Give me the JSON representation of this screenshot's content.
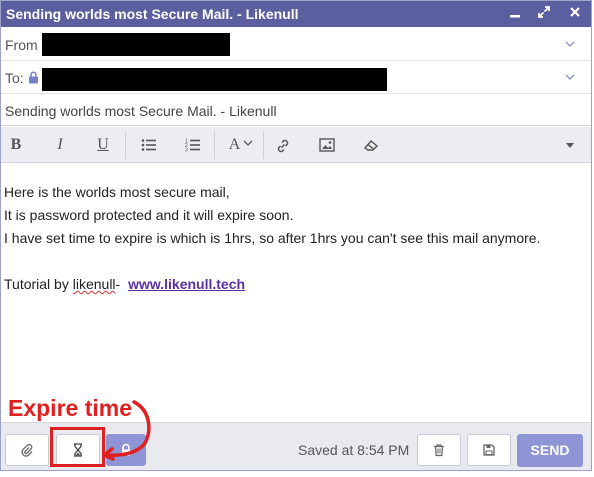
{
  "window": {
    "title": "Sending worlds most Secure Mail. - Likenull",
    "controls": [
      "minimize-icon",
      "maximize-icon",
      "close-icon"
    ]
  },
  "compose": {
    "from_label": "From",
    "to_label": "To:",
    "subject": "Sending worlds most Secure Mail. - Likenull"
  },
  "toolbar": {
    "bold": "B",
    "italic": "I",
    "underline": "U",
    "font_size": "A",
    "icons": [
      "bullet-list-icon",
      "numbered-list-icon",
      "font-size-icon",
      "link-icon",
      "image-icon",
      "eraser-icon",
      "more-dropdown-icon"
    ]
  },
  "body": {
    "line1": "Here is the worlds most secure mail,",
    "line2": "It is password protected and it will expire soon.",
    "line3": "I have set time to expire is which is 1hrs, so after 1hrs you can't see this mail anymore.",
    "line4_prefix": "Tutorial by ",
    "line4_name": "likenull",
    "line4_dash": "- ",
    "link": "www.likenull.tech"
  },
  "footer": {
    "saved_text": "Saved at 8:54 PM",
    "send_label": "SEND"
  },
  "annotation": {
    "label": "Expire time",
    "color": "#e02020"
  },
  "colors": {
    "titlebar": "#5b5f9f",
    "send": "#8e94d4",
    "link": "#5a2fa0"
  }
}
